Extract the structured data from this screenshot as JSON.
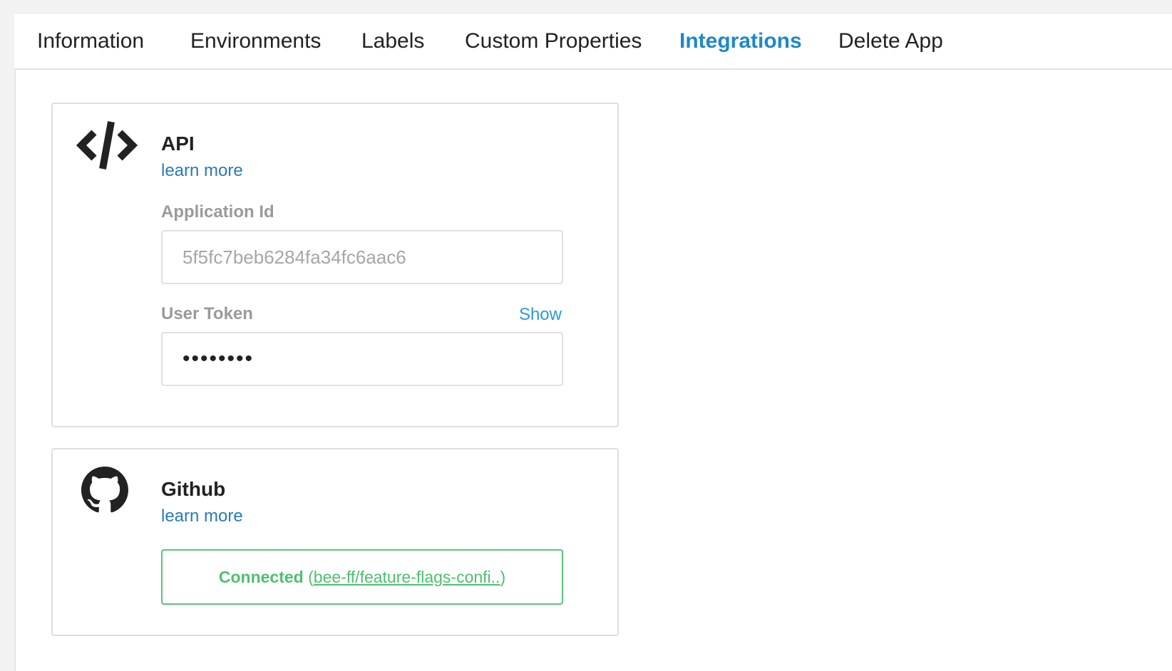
{
  "tabs": [
    {
      "label": "Information",
      "active": false
    },
    {
      "label": "Environments",
      "active": false
    },
    {
      "label": "Labels",
      "active": false
    },
    {
      "label": "Custom Properties",
      "active": false
    },
    {
      "label": "Integrations",
      "active": true
    },
    {
      "label": "Delete App",
      "active": false
    }
  ],
  "api": {
    "icon": "code-icon",
    "title": "API",
    "learn_more": "learn more",
    "application_id_label": "Application Id",
    "application_id_value": "5f5fc7beb6284fa34fc6aac6",
    "user_token_label": "User Token",
    "show_label": "Show",
    "user_token_value": "••••••••"
  },
  "github": {
    "icon": "github-icon",
    "title": "Github",
    "learn_more": "learn more",
    "status": "Connected",
    "open_paren": " (",
    "repo": "bee-ff/feature-flags-confi..",
    "close_paren": ")"
  },
  "colors": {
    "accent": "#1e88c8",
    "link": "#2a7ab8",
    "connected": "#4fbf6f"
  }
}
